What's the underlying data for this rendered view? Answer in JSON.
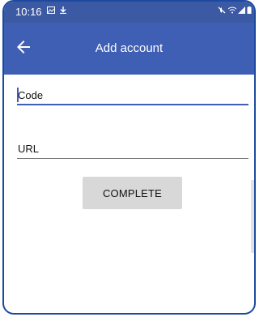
{
  "status_bar": {
    "time": "10:16",
    "icons": [
      "image-icon",
      "download-icon",
      "mute-icon",
      "wifi-icon",
      "signal-icon",
      "battery-icon"
    ]
  },
  "app_bar": {
    "title": "Add account",
    "back_icon": "arrow-left-icon"
  },
  "form": {
    "code": {
      "value": "",
      "placeholder": "Code"
    },
    "url": {
      "value": "",
      "placeholder": "URL"
    },
    "complete_label": "COMPLETE"
  },
  "colors": {
    "status_bar": "#3c5aa3",
    "app_bar": "#3f5fb4",
    "accent": "#3f5fb4",
    "button_bg": "#d8d8d8"
  }
}
